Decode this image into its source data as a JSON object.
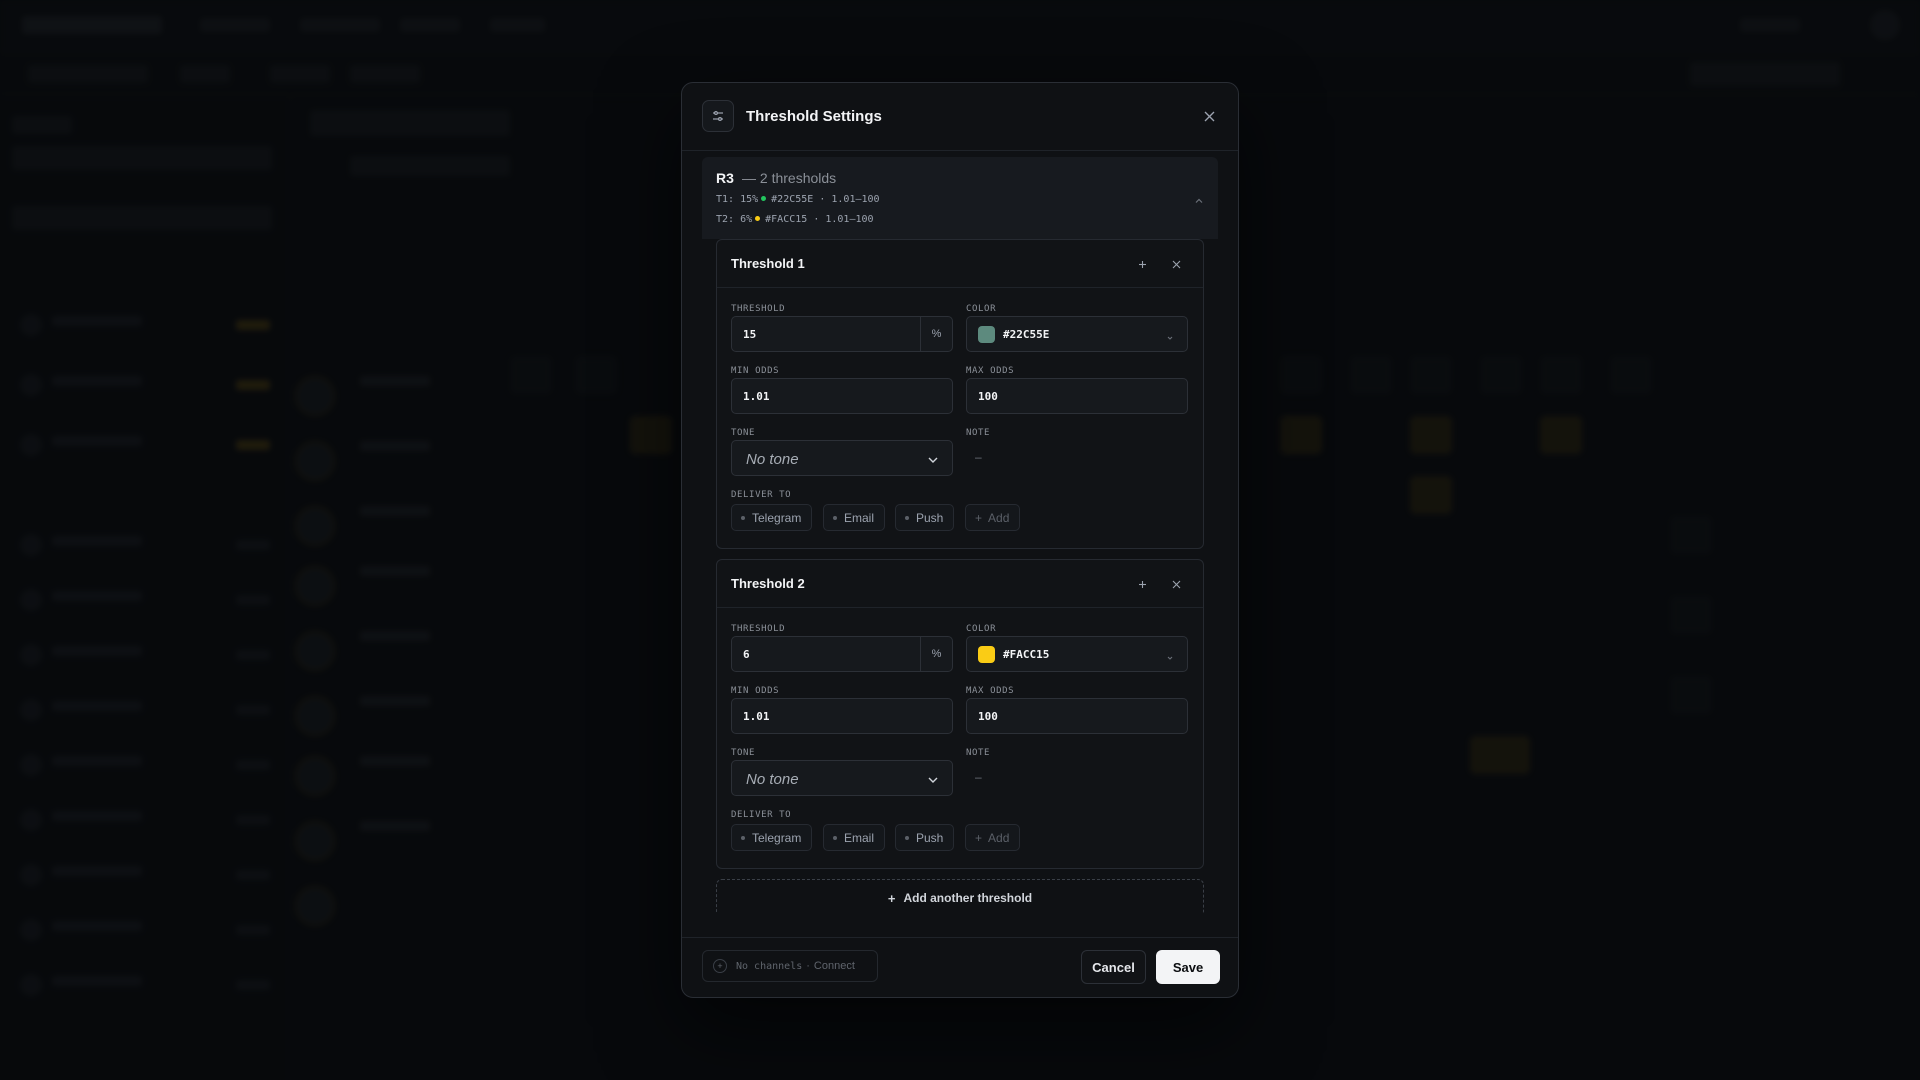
{
  "modal": {
    "title": "Threshold Settings",
    "header_icon": "sliders-icon",
    "close_icon": "close-icon"
  },
  "rule": {
    "name": "R3",
    "count_text": "— 2 thresholds",
    "summary": [
      {
        "prefix": "T1:",
        "pct": "15%",
        "color": "#22C55E",
        "range": "· 1.01–100"
      },
      {
        "prefix": "T2:",
        "pct": "6%",
        "color": "#FACC15",
        "range": "· 1.01–100"
      }
    ]
  },
  "labels": {
    "threshold": "THRESHOLD",
    "color": "COLOR",
    "min_odds": "MIN ODDS",
    "max_odds": "MAX ODDS",
    "tone": "TONE",
    "note": "NOTE",
    "deliver_to": "DELIVER TO",
    "percent": "%"
  },
  "thresholds": [
    {
      "title": "Threshold 1",
      "threshold": "15",
      "color_hex": "#22C55E",
      "swatch": "#5d8a7e",
      "min_odds": "1.01",
      "max_odds": "100",
      "tone": "No tone",
      "note": "–",
      "channels": [
        "Telegram",
        "Email",
        "Push"
      ],
      "add_label": "Add"
    },
    {
      "title": "Threshold 2",
      "threshold": "6",
      "color_hex": "#FACC15",
      "swatch": "#FACC15",
      "min_odds": "1.01",
      "max_odds": "100",
      "tone": "No tone",
      "note": "–",
      "channels": [
        "Telegram",
        "Email",
        "Push"
      ],
      "add_label": "Add"
    }
  ],
  "add_threshold_label": "Add another threshold",
  "footer": {
    "channels_status": "No channels",
    "connect_label": "Connect",
    "cancel_label": "Cancel",
    "save_label": "Save"
  }
}
